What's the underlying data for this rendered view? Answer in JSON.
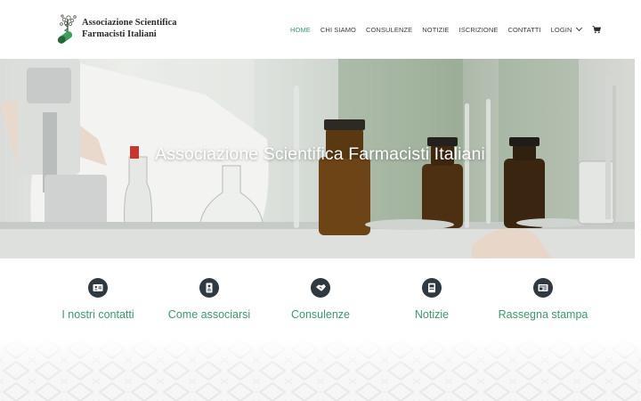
{
  "brand": {
    "line1": "Associazione Scientifica",
    "line2": "Farmacisti Italiani",
    "logo_icon": "caduceus-pill-logo",
    "accent_color": "#3a9a6a",
    "icon_bg_color": "#2f3942"
  },
  "nav": {
    "items": [
      {
        "label": "HOME",
        "active": true
      },
      {
        "label": "CHI SIAMO",
        "active": false
      },
      {
        "label": "CONSULENZE",
        "active": false
      },
      {
        "label": "NOTIZIE",
        "active": false
      },
      {
        "label": "ISCRIZIONE",
        "active": false
      },
      {
        "label": "CONTATTI",
        "active": false
      }
    ],
    "login_label": "LOGIN",
    "cart_icon": "cart-icon"
  },
  "hero": {
    "title": "Associazione Scientifica Farmacisti Italiani"
  },
  "features": [
    {
      "label": "I nostri contatti",
      "icon": "contact-card-icon"
    },
    {
      "label": "Come associarsi",
      "icon": "id-badge-icon"
    },
    {
      "label": "Consulenze",
      "icon": "handshake-icon"
    },
    {
      "label": "Notizie",
      "icon": "book-icon"
    },
    {
      "label": "Rassegna stampa",
      "icon": "newspaper-icon"
    }
  ]
}
